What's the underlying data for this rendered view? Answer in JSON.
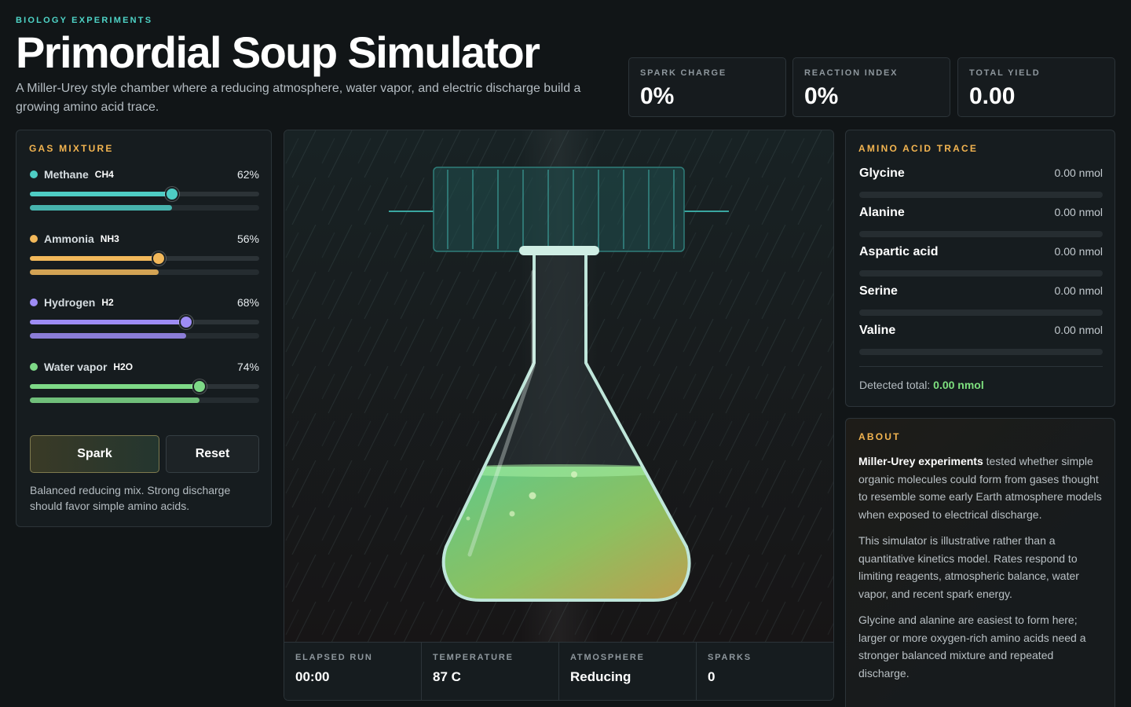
{
  "header": {
    "eyebrow": "BIOLOGY EXPERIMENTS",
    "title": "Primordial Soup Simulator",
    "subtitle": "A Miller-Urey style chamber where a reducing atmosphere, water vapor, and electric discharge build a growing amino acid trace."
  },
  "stats": [
    {
      "label": "SPARK CHARGE",
      "value": "0%"
    },
    {
      "label": "REACTION INDEX",
      "value": "0%"
    },
    {
      "label": "TOTAL YIELD",
      "value": "0.00"
    }
  ],
  "gas_mixture": {
    "heading": "GAS MIXTURE",
    "gases": [
      {
        "name": "Methane",
        "formula": "CH4",
        "percent_label": "62%",
        "value": 0.62,
        "level": 0.62,
        "color": "#4ecdc4"
      },
      {
        "name": "Ammonia",
        "formula": "NH3",
        "percent_label": "56%",
        "value": 0.56,
        "level": 0.56,
        "color": "#f2b85a"
      },
      {
        "name": "Hydrogen",
        "formula": "H2",
        "percent_label": "68%",
        "value": 0.68,
        "level": 0.68,
        "color": "#9e8cf5"
      },
      {
        "name": "Water vapor",
        "formula": "H2O",
        "percent_label": "74%",
        "value": 0.74,
        "level": 0.74,
        "color": "#7ed987"
      }
    ],
    "spark_label": "Spark",
    "reset_label": "Reset",
    "note": "Balanced reducing mix. Strong discharge should favor simple amino acids."
  },
  "chamber": {
    "readouts": [
      {
        "label": "ELAPSED RUN",
        "value": "00:00"
      },
      {
        "label": "TEMPERATURE",
        "value": "87 C"
      },
      {
        "label": "ATMOSPHERE",
        "value": "Reducing"
      },
      {
        "label": "SPARKS",
        "value": "0"
      }
    ]
  },
  "amino_trace": {
    "heading": "AMINO ACID TRACE",
    "acids": [
      {
        "name": "Glycine",
        "value": "0.00 nmol",
        "level": 0
      },
      {
        "name": "Alanine",
        "value": "0.00 nmol",
        "level": 0
      },
      {
        "name": "Aspartic acid",
        "value": "0.00 nmol",
        "level": 0
      },
      {
        "name": "Serine",
        "value": "0.00 nmol",
        "level": 0
      },
      {
        "name": "Valine",
        "value": "0.00 nmol",
        "level": 0
      }
    ],
    "total_label": "Detected total:",
    "total_value": "0.00 nmol"
  },
  "about": {
    "heading": "ABOUT",
    "p1_bold": "Miller-Urey experiments",
    "p1_rest": "tested whether simple organic molecules could form from gases thought to resemble some early Earth atmosphere models when exposed to electrical discharge.",
    "p2": "This simulator is illustrative rather than a quantitative kinetics model. Rates respond to limiting reagents, atmospheric balance, water vapor, and recent spark energy.",
    "p3": "Glycine and alanine are easiest to form here; larger or more oxygen-rich amino acids need a stronger balanced mixture and repeated discharge."
  }
}
